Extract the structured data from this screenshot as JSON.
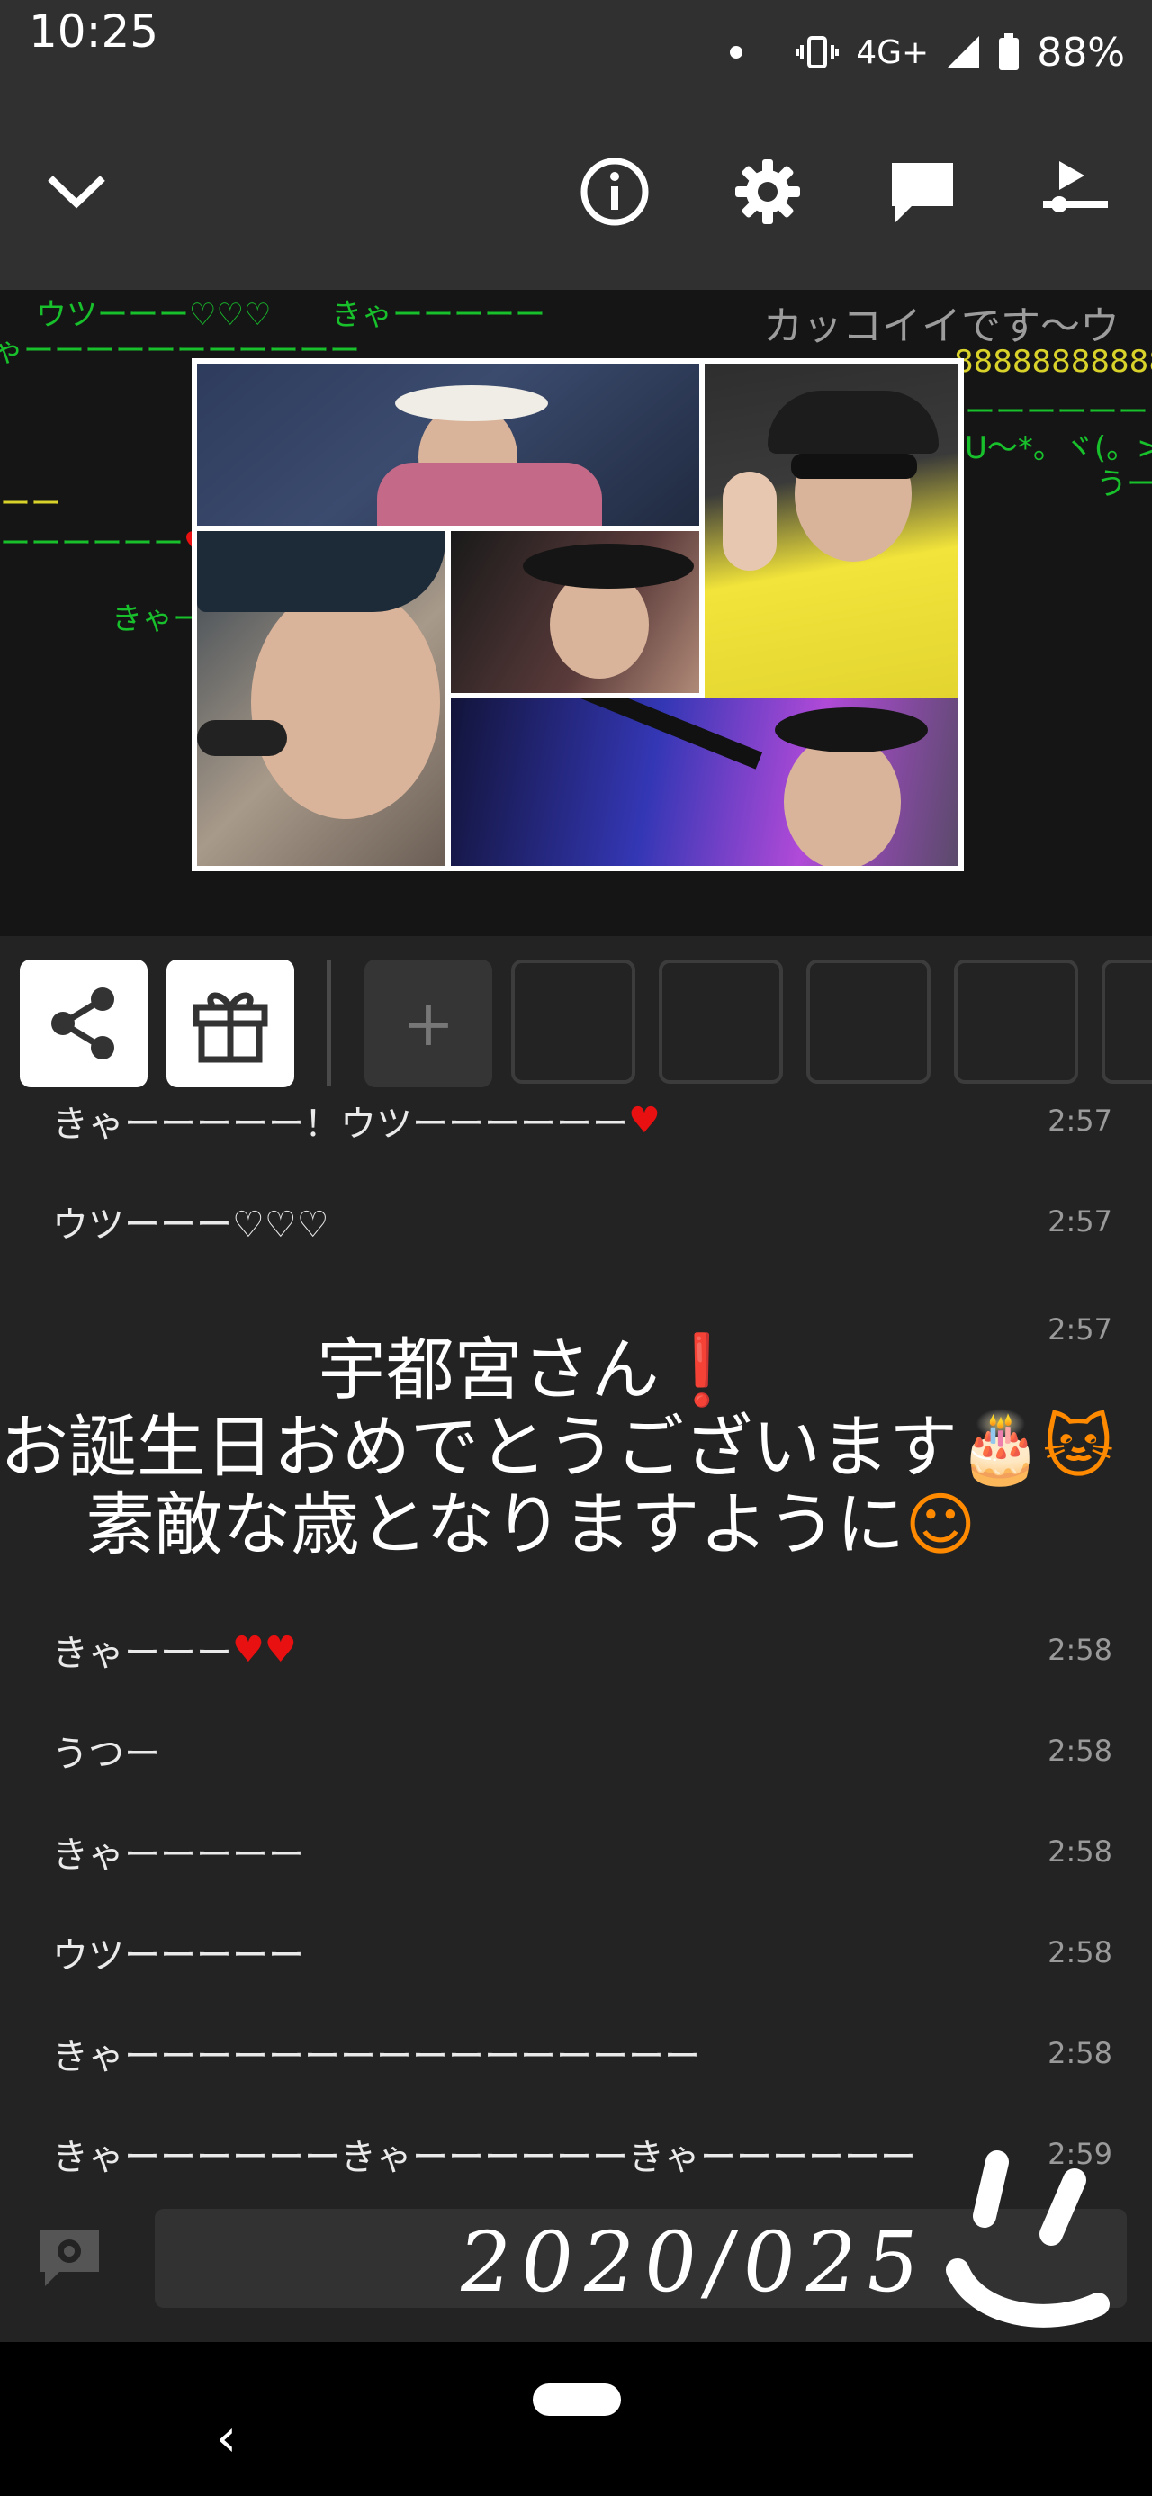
{
  "status_bar": {
    "time": "10:25",
    "network": "4G+",
    "battery": "88%"
  },
  "toolbar": {
    "icons": [
      "chevron-down-icon",
      "info-icon",
      "gear-icon",
      "comment-icon",
      "playlist-icon"
    ]
  },
  "video": {
    "danmaku": [
      "ウツーーー♡♡♡",
      "きゃーーーーー",
      "ゃーーーーーーーーーーー",
      "カッコイイです～ウ",
      "88888888888888",
      "ーーーーーー",
      "U～*。ヾ(。>v",
      "うー",
      "ーー",
      "ーーーーーー",
      "きゃー"
    ]
  },
  "actions": {
    "share_icon": "share-icon",
    "gift_icon": "gift-icon",
    "add_label": "+"
  },
  "comments": [
    {
      "text": "きゃーーーーー！ウツーーーーーー",
      "time": "2:57",
      "heart": "♥"
    },
    {
      "text": "ウツーーー♡♡♡",
      "time": "2:57"
    },
    {
      "text": "きゃーーー",
      "time": "2:58",
      "heart": "♥♥"
    },
    {
      "text": "うつー",
      "time": "2:58"
    },
    {
      "text": "きゃーーーーー",
      "time": "2:58"
    },
    {
      "text": "ウツーーーーー",
      "time": "2:58"
    },
    {
      "text": "きゃーーーーーーーーーーーーーーーー",
      "time": "2:58"
    },
    {
      "text": "きゃーーーーーーきゃーーーーーーきゃーーーーーー",
      "time": "2:59"
    }
  ],
  "big_comment": {
    "time": "2:57",
    "line1": "宇都宮さん",
    "line1_mark": "❗",
    "line2": "お誕生日おめでとうございます",
    "line2_marks": "🎂🐱",
    "line3": "素敵な歳となりますように",
    "line3_mark": "☺"
  },
  "handwriting": "2020/025"
}
